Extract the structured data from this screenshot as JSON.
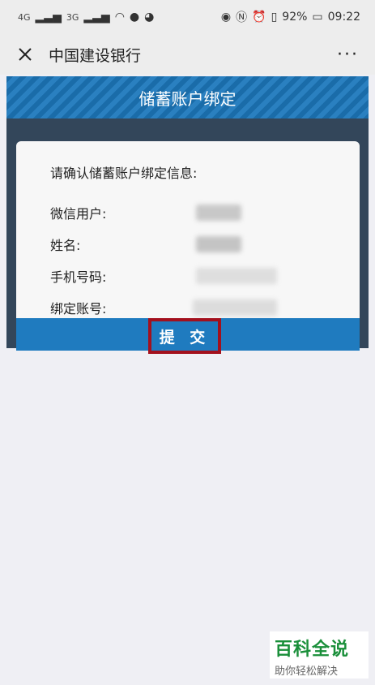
{
  "status_bar": {
    "signal1": "4G",
    "signal2": "3G",
    "battery": "92%",
    "time": "09:22"
  },
  "nav": {
    "title": "中国建设银行",
    "more": "···"
  },
  "page": {
    "header": "储蓄账户绑定",
    "confirm_title": "请确认储蓄账户绑定信息:",
    "fields": [
      {
        "label": "微信用户:"
      },
      {
        "label": "姓名:"
      },
      {
        "label": "手机号码:"
      },
      {
        "label": "绑定账号:"
      }
    ],
    "submit": "提 交"
  },
  "watermark": {
    "main": "百科全说",
    "sub": "助你轻松解决"
  }
}
